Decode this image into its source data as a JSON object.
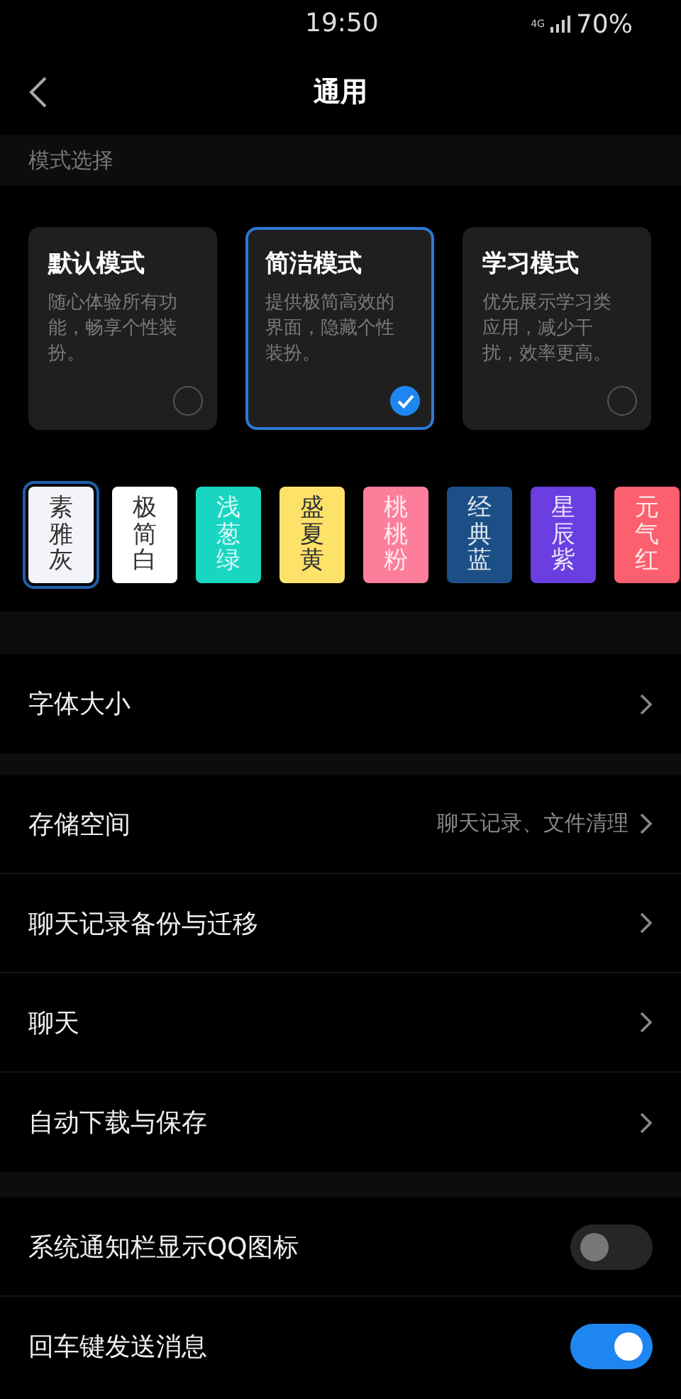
{
  "status_bar": {
    "time": "19:50",
    "network": "4G",
    "battery": "70%"
  },
  "header": {
    "title": "通用"
  },
  "mode_section": {
    "label": "模式选择"
  },
  "modes": [
    {
      "title": "默认模式",
      "description": "随心体验所有功能，畅享个性装扮。",
      "selected": false
    },
    {
      "title": "简洁模式",
      "description": "提供极简高效的界面，隐藏个性装扮。",
      "selected": true
    },
    {
      "title": "学习模式",
      "description": "优先展示学习类应用，减少干扰，效率更高。",
      "selected": false
    }
  ],
  "themes": [
    {
      "label": "素雅灰",
      "color": "#f3f4f8",
      "selected": true
    },
    {
      "label": "极简白",
      "color": "#ffffff",
      "selected": false
    },
    {
      "label": "浅葱绿",
      "color": "#19d6c2",
      "selected": false
    },
    {
      "label": "盛夏黄",
      "color": "#fde26a",
      "selected": false
    },
    {
      "label": "桃桃粉",
      "color": "#fc7e9a",
      "selected": false
    },
    {
      "label": "经典蓝",
      "color": "#1b4f86",
      "selected": false
    },
    {
      "label": "星辰紫",
      "color": "#6a3ee0",
      "selected": false
    },
    {
      "label": "元气红",
      "color": "#fc5f6e",
      "selected": false
    }
  ],
  "groups": [
    [
      {
        "kind": "link",
        "label": "字体大小"
      }
    ],
    [
      {
        "kind": "link",
        "label": "存储空间",
        "value": "聊天记录、文件清理"
      },
      {
        "kind": "link",
        "label": "聊天记录备份与迁移"
      },
      {
        "kind": "link",
        "label": "聊天"
      },
      {
        "kind": "link",
        "label": "自动下载与保存"
      }
    ],
    [
      {
        "kind": "toggle",
        "label": "系统通知栏显示QQ图标",
        "on": false
      },
      {
        "kind": "toggle",
        "label": "回车键发送消息",
        "on": true
      }
    ]
  ]
}
